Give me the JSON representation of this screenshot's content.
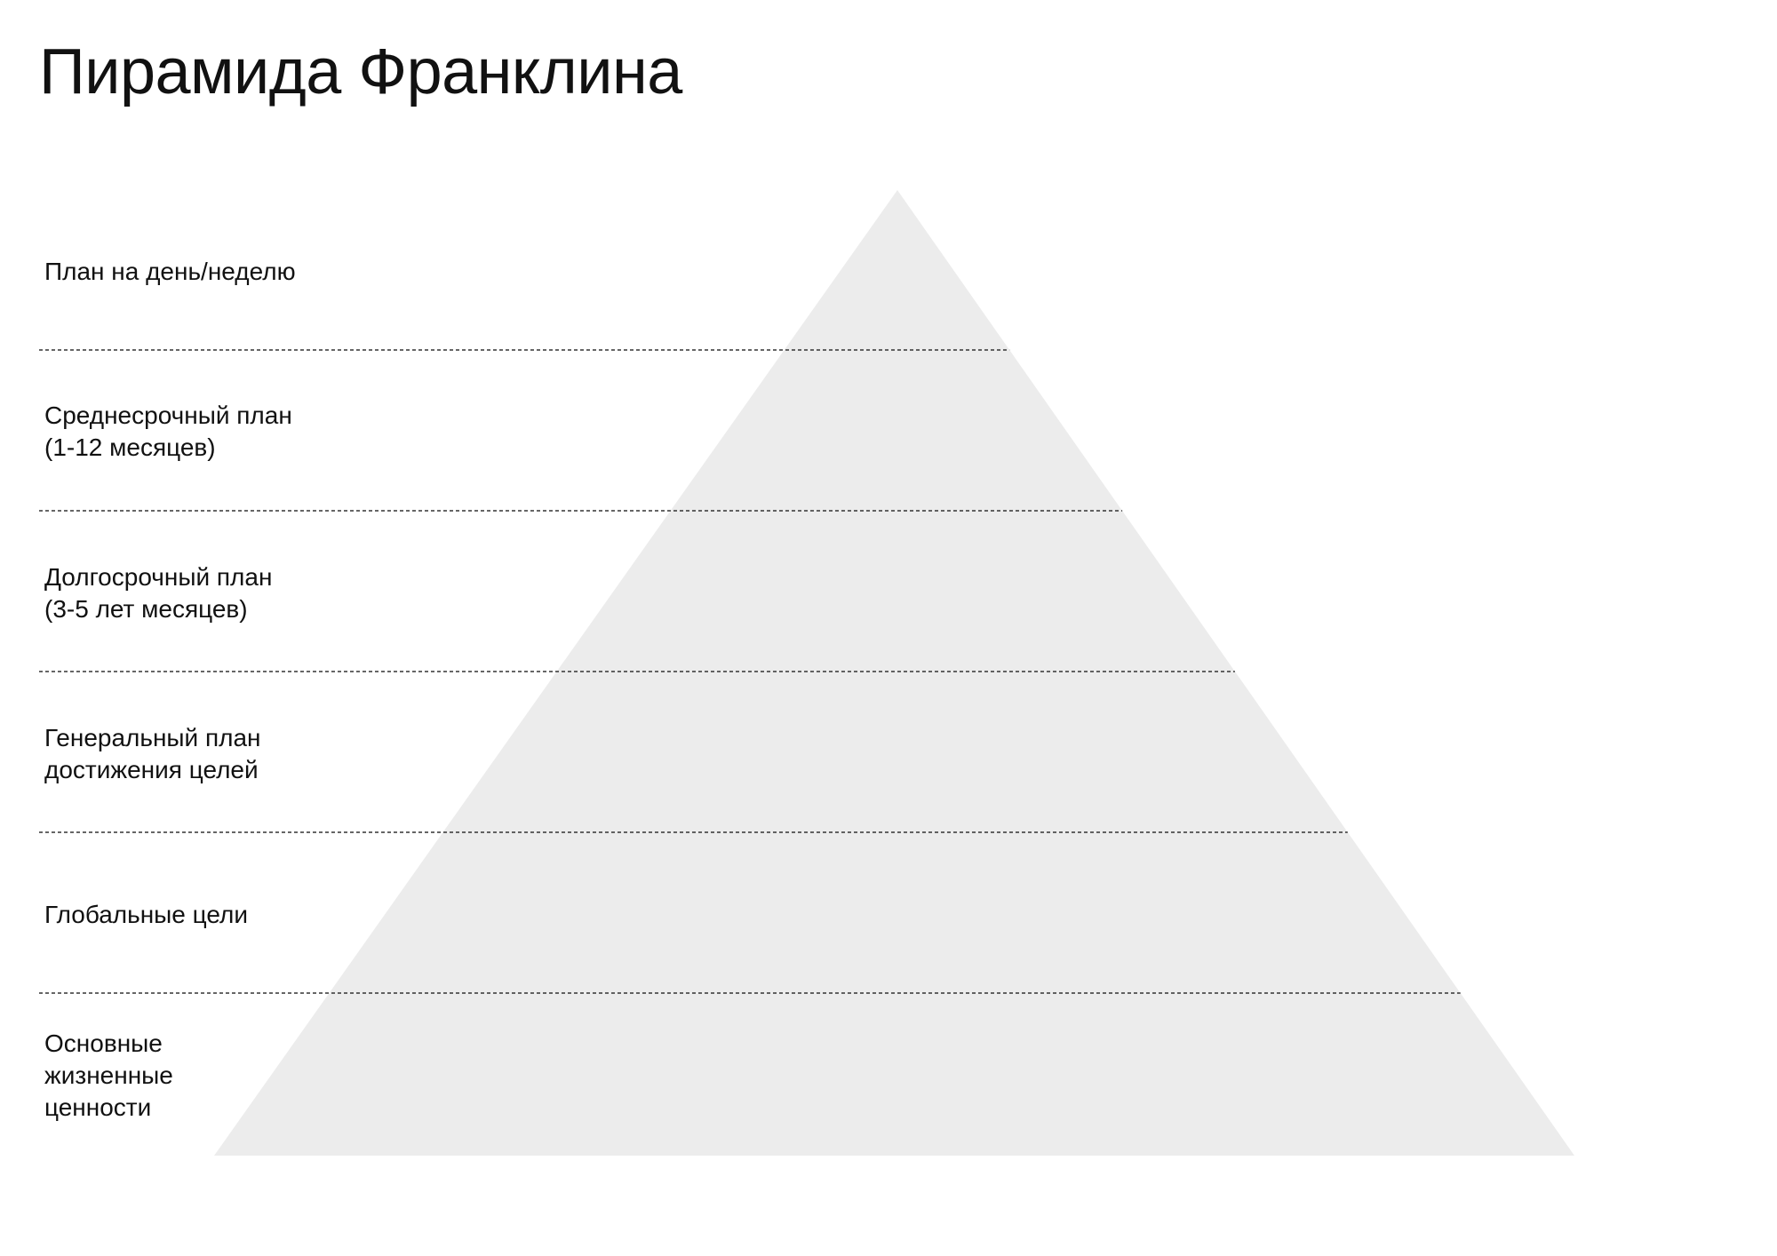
{
  "title": "Пирамида Франклина",
  "levels": [
    {
      "label": "План на день/неделю"
    },
    {
      "label": "Среднесрочный план\n(1-12 месяцев)"
    },
    {
      "label": "Долгосрочный план\n(3-5 лет месяцев)"
    },
    {
      "label": "Генеральный план\nдостижения целей"
    },
    {
      "label": "Глобальные цели"
    },
    {
      "label": "Основные\nжизненные\nценности"
    }
  ],
  "colors": {
    "pyramid_fill": "#ececec",
    "divider": "#333333",
    "text": "#111111"
  }
}
